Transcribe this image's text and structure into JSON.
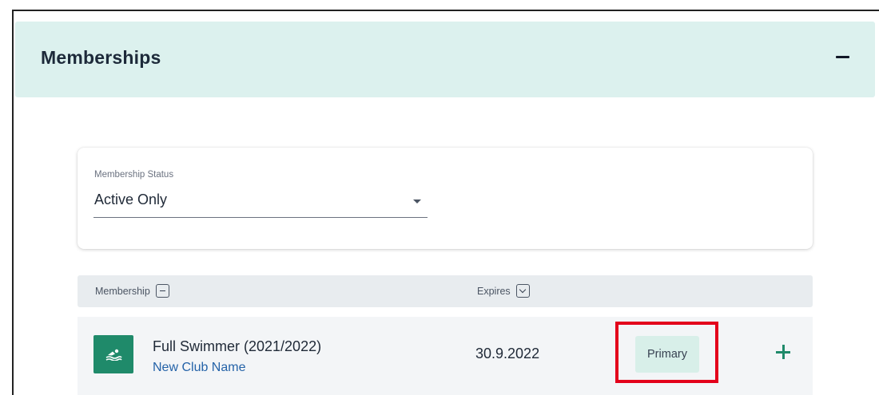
{
  "panel": {
    "title": "Memberships"
  },
  "filter": {
    "label": "Membership Status",
    "value": "Active Only"
  },
  "table": {
    "columns": [
      {
        "label": "Membership",
        "control": "collapse-icon"
      },
      {
        "label": "Expires",
        "control": "chevron-down-icon"
      }
    ],
    "rows": [
      {
        "icon": "swimmer-icon",
        "name": "Full Swimmer (2021/2022)",
        "club": "New Club Name",
        "expires": "30.9.2022",
        "badge": "Primary"
      }
    ]
  },
  "colors": {
    "header_bg": "#dcf1ee",
    "accent": "#1f8a6a",
    "link": "#2563a8",
    "highlight": "#e3001b"
  }
}
